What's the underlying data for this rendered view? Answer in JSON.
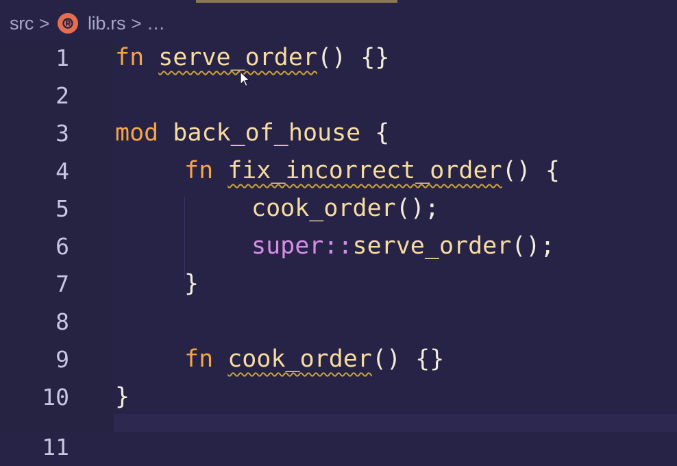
{
  "breadcrumb": {
    "folder": "src",
    "separator": ">",
    "file": "lib.rs",
    "ellipsis": "…",
    "file_icon": "rust-icon"
  },
  "editor": {
    "lines": [
      {
        "number": "1"
      },
      {
        "number": "2"
      },
      {
        "number": "3"
      },
      {
        "number": "4"
      },
      {
        "number": "5"
      },
      {
        "number": "6"
      },
      {
        "number": "7"
      },
      {
        "number": "8"
      },
      {
        "number": "9"
      },
      {
        "number": "10"
      },
      {
        "number": "11"
      }
    ],
    "tokens": {
      "l1_kw": "fn",
      "l1_name": "serve_order",
      "l1_rest": "() {}",
      "l3_kw": "mod",
      "l3_name": "back_of_house",
      "l3_rest": " {",
      "l4_kw": "fn",
      "l4_name": "fix_incorrect_order",
      "l4_rest": "() {",
      "l5_call": "cook_order",
      "l5_rest": "();",
      "l6_super": "super",
      "l6_sep": "::",
      "l6_call": "serve_order",
      "l6_rest": "();",
      "l7_close": "}",
      "l9_kw": "fn",
      "l9_name": "cook_order",
      "l9_rest": "() {}",
      "l10_close": "}"
    }
  },
  "colors": {
    "background": "#272346",
    "keyword": "#f5a547",
    "function": "#f7dca0",
    "super": "#d58ee8",
    "warning_squiggle": "#caa43a",
    "rust_icon": "#e56e51"
  }
}
